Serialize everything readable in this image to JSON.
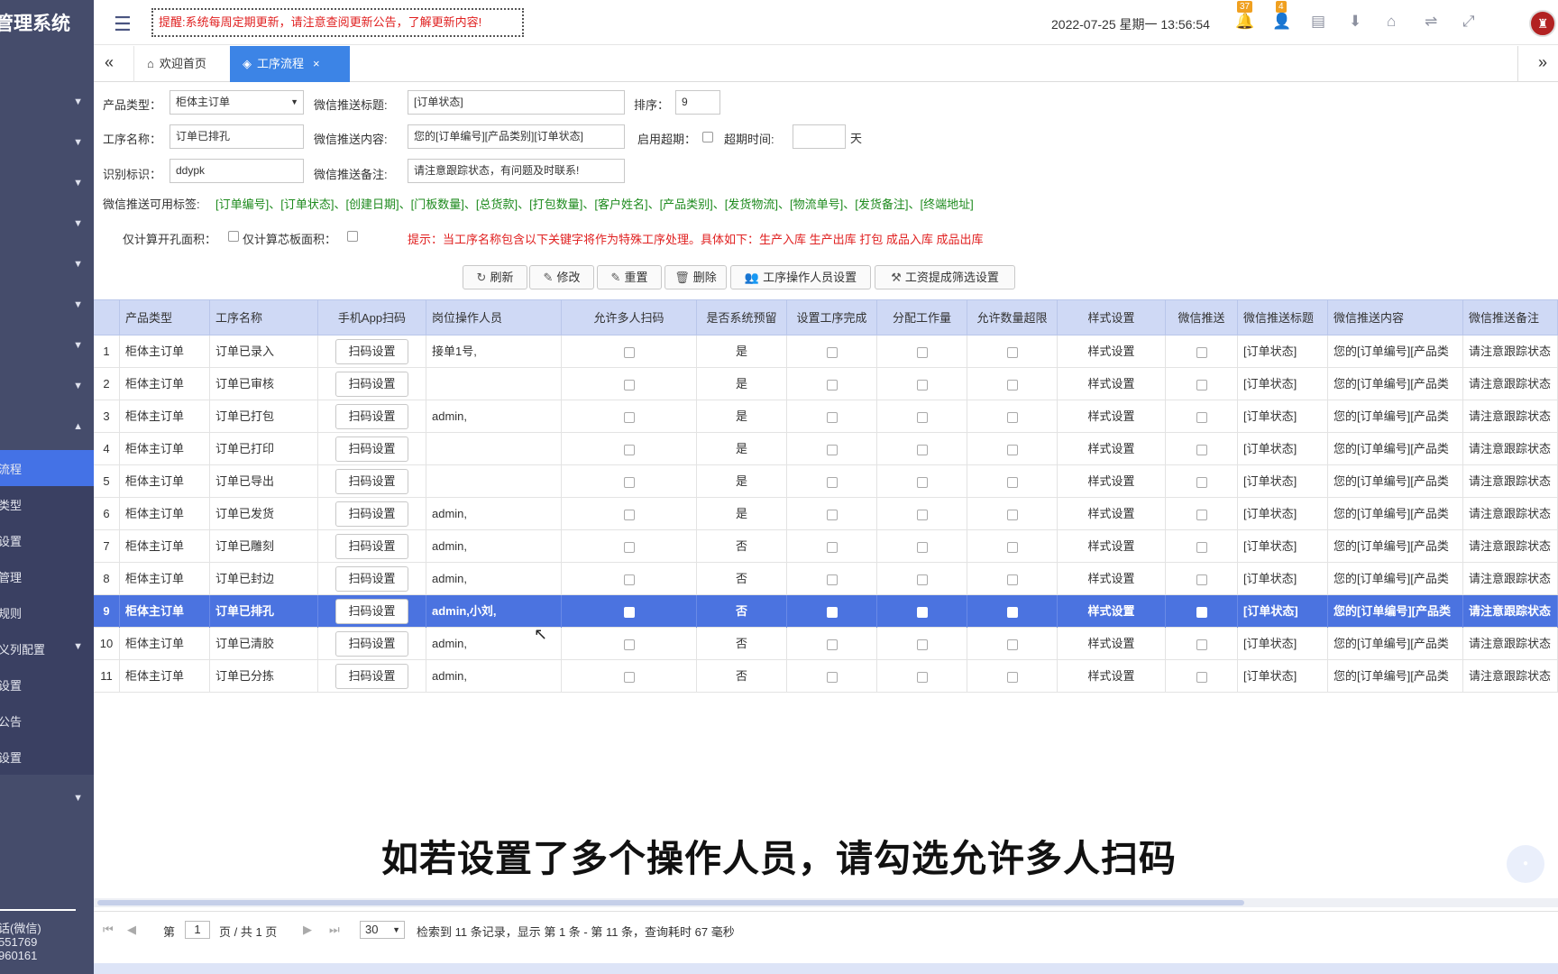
{
  "sidebar": {
    "brand": "管理系统",
    "items": [
      {
        "label": "",
        "arrow": "▼"
      },
      {
        "label": "",
        "arrow": "▼"
      },
      {
        "label": "",
        "arrow": "▼"
      },
      {
        "label": "",
        "arrow": "▼"
      },
      {
        "label": "",
        "arrow": "▼"
      },
      {
        "label": "",
        "arrow": "▼"
      },
      {
        "label": "",
        "arrow": "▼"
      },
      {
        "label": "",
        "arrow": "▼"
      },
      {
        "label": "",
        "arrow": "▲"
      }
    ],
    "sub_items": [
      {
        "label": "流程"
      },
      {
        "label": "类型"
      },
      {
        "label": "设置"
      },
      {
        "label": "管理"
      },
      {
        "label": "规则"
      },
      {
        "label": "义列配置",
        "arrow": "▼"
      },
      {
        "label": "设置"
      },
      {
        "label": "公告"
      },
      {
        "label": "设置"
      }
    ],
    "last_arrow": "▼",
    "contact_line1": "话(微信)",
    "contact_line2": "551769",
    "contact_line3": "960161"
  },
  "header": {
    "toggle_icon": "☰",
    "notice": "提醒:系统每周定期更新，请注意查阅更新公告，了解更新内容!",
    "datetime": "2022-07-25  星期一  13:56:54",
    "badge_bell": "37",
    "badge_user": "4"
  },
  "tabs": {
    "nav_left": "«",
    "nav_right": "»",
    "home": "欢迎首页",
    "active": "工序流程",
    "close": "×"
  },
  "form": {
    "product_type_label": "产品类型：",
    "product_type_value": "柜体主订单",
    "wx_title_label": "微信推送标题:",
    "wx_title_value": "[订单状态]",
    "sort_label": "排序：",
    "sort_value": "9",
    "proc_name_label": "工序名称：",
    "proc_name_value": "订单已排孔",
    "wx_content_label": "微信推送内容:",
    "wx_content_value": "您的[订单编号][产品类别][订单状态]",
    "enable_overdue_label": "启用超期：",
    "overdue_time_label": "超期时间:",
    "overdue_unit": "天",
    "ident_label": "识别标识：",
    "ident_value": "ddypk",
    "wx_note_label": "微信推送备注:",
    "wx_note_value": "请注意跟踪状态，有问题及时联系!",
    "tags_label": "微信推送可用标签:",
    "tags": "[订单编号]、[订单状态]、[创建日期]、[门板数量]、[总货款]、[打包数量]、[客户姓名]、[产品类别]、[发货物流]、[物流单号]、[发货备注]、[终端地址]",
    "calc_hole_label": "仅计算开孔面积：",
    "calc_core_label": "仅计算芯板面积：",
    "hint": "提示：当工序名称包含以下关键字将作为特殊工序处理。具体如下：生产入库 生产出库 打包 成品入库 成品出库"
  },
  "toolbar": {
    "refresh": "刷新",
    "edit": "修改",
    "reset": "重置",
    "delete": "删除",
    "operator_setting": "工序操作人员设置",
    "wage_filter": "工资提成筛选设置"
  },
  "grid": {
    "headers": [
      "",
      "产品类型",
      "工序名称",
      "手机App扫码",
      "岗位操作人员",
      "允许多人扫码",
      "是否系统预留",
      "设置工序完成",
      "分配工作量",
      "允许数量超限",
      "样式设置",
      "微信推送",
      "微信推送标题",
      "微信推送内容",
      "微信推送备注"
    ],
    "scan_btn": "扫码设置",
    "style_text": "样式设置",
    "rows": [
      {
        "no": "1",
        "type": "柜体主订单",
        "name": "订单已录入",
        "ops": "接单1号,",
        "reserved": "是",
        "title": "[订单状态]",
        "content": "您的[订单编号][产品类",
        "note": "请注意跟踪状态"
      },
      {
        "no": "2",
        "type": "柜体主订单",
        "name": "订单已审核",
        "ops": "",
        "reserved": "是",
        "title": "[订单状态]",
        "content": "您的[订单编号][产品类",
        "note": "请注意跟踪状态"
      },
      {
        "no": "3",
        "type": "柜体主订单",
        "name": "订单已打包",
        "ops": "admin,",
        "reserved": "是",
        "title": "[订单状态]",
        "content": "您的[订单编号][产品类",
        "note": "请注意跟踪状态"
      },
      {
        "no": "4",
        "type": "柜体主订单",
        "name": "订单已打印",
        "ops": "",
        "reserved": "是",
        "title": "[订单状态]",
        "content": "您的[订单编号][产品类",
        "note": "请注意跟踪状态"
      },
      {
        "no": "5",
        "type": "柜体主订单",
        "name": "订单已导出",
        "ops": "",
        "reserved": "是",
        "title": "[订单状态]",
        "content": "您的[订单编号][产品类",
        "note": "请注意跟踪状态"
      },
      {
        "no": "6",
        "type": "柜体主订单",
        "name": "订单已发货",
        "ops": "admin,",
        "reserved": "是",
        "title": "[订单状态]",
        "content": "您的[订单编号][产品类",
        "note": "请注意跟踪状态"
      },
      {
        "no": "7",
        "type": "柜体主订单",
        "name": "订单已雕刻",
        "ops": "admin,",
        "reserved": "否",
        "title": "[订单状态]",
        "content": "您的[订单编号][产品类",
        "note": "请注意跟踪状态"
      },
      {
        "no": "8",
        "type": "柜体主订单",
        "name": "订单已封边",
        "ops": "admin,",
        "reserved": "否",
        "title": "[订单状态]",
        "content": "您的[订单编号][产品类",
        "note": "请注意跟踪状态"
      },
      {
        "no": "9",
        "type": "柜体主订单",
        "name": "订单已排孔",
        "ops": "admin,小刘,",
        "reserved": "否",
        "title": "[订单状态]",
        "content": "您的[订单编号][产品类",
        "note": "请注意跟踪状态",
        "selected": true
      },
      {
        "no": "10",
        "type": "柜体主订单",
        "name": "订单已清胶",
        "ops": "admin,",
        "reserved": "否",
        "title": "[订单状态]",
        "content": "您的[订单编号][产品类",
        "note": "请注意跟踪状态"
      },
      {
        "no": "11",
        "type": "柜体主订单",
        "name": "订单已分拣",
        "ops": "admin,",
        "reserved": "否",
        "title": "[订单状态]",
        "content": "您的[订单编号][产品类",
        "note": "请注意跟踪状态"
      }
    ]
  },
  "subtitle": "如若设置了多个操作人员，请勾选允许多人扫码",
  "pager": {
    "page_prefix": "第",
    "page_value": "1",
    "page_suffix": "页 / 共 1 页",
    "page_size": "30",
    "summary": "检索到 11 条记录，显示 第 1 条 - 第 11 条，查询耗时 67 毫秒"
  },
  "colors": {
    "accent": "#4b73e0",
    "sidebar": "#454c6b",
    "tab_active": "#3c84e6",
    "notice_red": "#e02020",
    "tag_green": "#1d8a1d"
  }
}
